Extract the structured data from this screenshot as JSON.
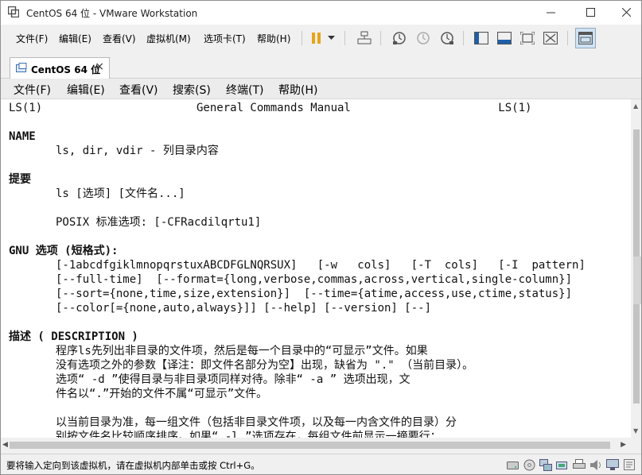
{
  "window": {
    "title": "CentOS 64 位 - VMware Workstation"
  },
  "app_menu": [
    {
      "label": "文件(F)"
    },
    {
      "label": "编辑(E)"
    },
    {
      "label": "查看(V)"
    },
    {
      "label": "虚拟机(M)"
    },
    {
      "label": "选项卡(T)"
    },
    {
      "label": "帮助(H)"
    }
  ],
  "tab": {
    "label": "CentOS 64 位",
    "close": "×"
  },
  "guest_menu": [
    {
      "label": "文件(F)"
    },
    {
      "label": "编辑(E)"
    },
    {
      "label": "查看(V)"
    },
    {
      "label": "搜索(S)"
    },
    {
      "label": "终端(T)"
    },
    {
      "label": "帮助(H)"
    }
  ],
  "terminal": {
    "lines": [
      "LS(1)                       General Commands Manual                      LS(1)",
      "",
      "NAME",
      "       ls, dir, vdir - 列目录内容",
      "",
      "提要",
      "       ls [选项] [文件名...]",
      "",
      "       POSIX 标准选项: [-CFRacdilqrtu1]",
      "",
      "GNU 选项 (短格式):",
      "       [-1abcdfgiklmnopqrstuxABCDFGLNQRSUX]   [-w   cols]   [-T  cols]   [-I  pattern]",
      "       [--full-time]  [--format={long,verbose,commas,across,vertical,single-column}]",
      "       [--sort={none,time,size,extension}]  [--time={atime,access,use,ctime,status}]",
      "       [--color[={none,auto,always}]] [--help] [--version] [--]",
      "",
      "描述 ( DESCRIPTION )",
      "       程序ls先列出非目录的文件项，然后是每一个目录中的“可显示”文件。如果",
      "       没有选项之外的参数【译注：即文件名部分为空】出现，缺省为 \".\" （当前目录）。",
      "       选项“ -d ”使得目录与非目录项同样对待。除非“ -a ” 选项出现，文",
      "       件名以“.”开始的文件不属“可显示”文件。",
      "",
      "       以当前目录为准，每一组文件（包括非目录文件项，以及每一内含文件的目录）分",
      "       别按文件名比较顺序排序。如果“ -l ”选项存在，每组文件前显示一摘要行："
    ],
    "bold_lines": [
      2,
      5,
      10,
      16
    ]
  },
  "statusbar": {
    "message": "要将输入定向到该虚拟机，请在虚拟机内部单击或按 Ctrl+G。"
  },
  "colors": {
    "accent": "#2a74c4",
    "pause": "#e8a317"
  }
}
